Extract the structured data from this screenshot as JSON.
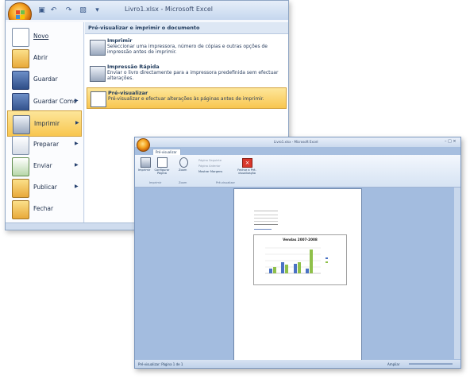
{
  "main_window": {
    "title": "Livro1.xlsx - Microsoft Excel",
    "menu": {
      "items": [
        {
          "label": "Novo"
        },
        {
          "label": "Abrir"
        },
        {
          "label": "Guardar"
        },
        {
          "label": "Guardar Como"
        },
        {
          "label": "Imprimir"
        },
        {
          "label": "Preparar"
        },
        {
          "label": "Enviar"
        },
        {
          "label": "Publicar"
        },
        {
          "label": "Fechar"
        }
      ],
      "submenu": {
        "title": "Pré-visualizar e imprimir o documento",
        "items": [
          {
            "title": "Imprimir",
            "desc": "Seleccionar uma impressora, número de cópias e outras opções de impressão antes de imprimir."
          },
          {
            "title": "Impressão Rápida",
            "desc": "Enviar o livro directamente para a impressora predefinida sem efectuar alterações."
          },
          {
            "title": "Pré-visualizar",
            "desc": "Pré-visualizar e efectuar alterações às páginas antes de imprimir."
          }
        ]
      }
    }
  },
  "preview_window": {
    "title": "Livro1.xlsx - Microsoft Excel",
    "tab": "Pré-visualizar",
    "ribbon": {
      "buttons": {
        "imprimir": "Imprimir",
        "configurar": "Configurar Página",
        "zoom": "Zoom",
        "pagina_seguinte": "Página Seguinte",
        "pagina_anterior": "Página Anterior",
        "mostrar_margens": "Mostrar Margens",
        "fechar": "Fechar a Pré-visualização"
      },
      "groups": {
        "imprimir": "Imprimir",
        "zoom": "Zoom",
        "previsualizar": "Pré-visualizar"
      }
    },
    "page": {
      "chart_title": "Vendas 2007-2008"
    },
    "status": "Pré-visualizar: Página 1 de 1",
    "zoom_label": "Ampliar"
  },
  "colors": {
    "window_bg": "#dbe5f1",
    "highlight": "#f8c64f",
    "preview_bg": "#a3bcdf"
  }
}
